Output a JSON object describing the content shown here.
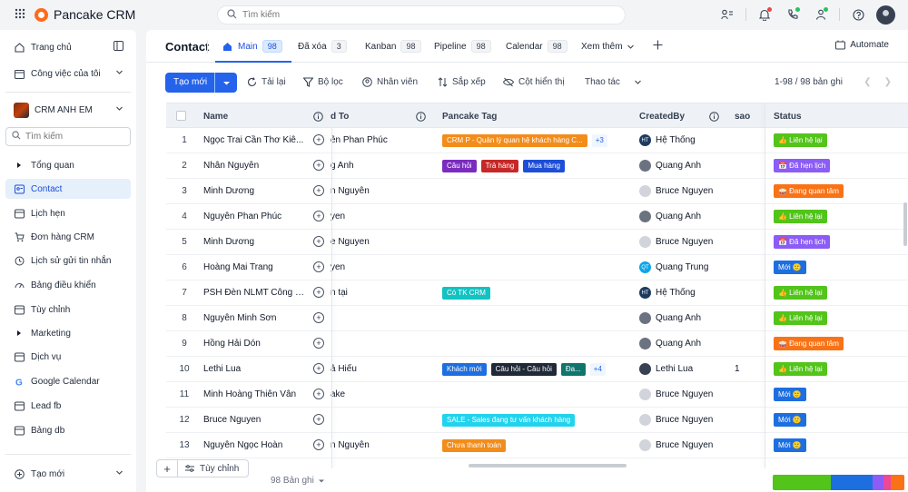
{
  "app": {
    "name": "Pancake CRM",
    "search_placeholder": "Tìm kiếm"
  },
  "sidebar": {
    "top_items": [
      {
        "label": "Trang chủ",
        "icon": "home-icon"
      },
      {
        "label": "Công việc của tôi",
        "icon": "calendar-check-icon"
      }
    ],
    "team": "CRM ANH EM",
    "search_placeholder": "Tìm kiếm",
    "items": [
      {
        "label": "Tổng quan",
        "icon": "caret-right-icon"
      },
      {
        "label": "Contact",
        "icon": "contact-icon"
      },
      {
        "label": "Lịch hẹn",
        "icon": "calendar-icon"
      },
      {
        "label": "Đơn hàng CRM",
        "icon": "cart-icon"
      },
      {
        "label": "Lịch sử gửi tin nhắn",
        "icon": "history-icon"
      },
      {
        "label": "Bảng điều khiển",
        "icon": "dashboard-icon"
      },
      {
        "label": "Tùy chỉnh",
        "icon": "puzzle-icon"
      },
      {
        "label": "Marketing",
        "icon": "caret-right-icon"
      },
      {
        "label": "Dịch vụ",
        "icon": "service-icon"
      },
      {
        "label": "Google Calendar",
        "icon": "google-icon"
      },
      {
        "label": "Lead fb",
        "icon": "table-icon"
      },
      {
        "label": "Bảng db",
        "icon": "table-icon"
      }
    ],
    "new_label": "Tạo mới"
  },
  "header": {
    "title": "Contact",
    "tabs": [
      {
        "label": "Main",
        "count": "98"
      },
      {
        "label": "Đã xóa",
        "count": "3"
      },
      {
        "label": "Kanban",
        "count": "98"
      },
      {
        "label": "Pipeline",
        "count": "98"
      },
      {
        "label": "Calendar",
        "count": "98"
      }
    ],
    "more_label": "Xem thêm",
    "automate_label": "Automate"
  },
  "toolbar": {
    "new_label": "Tạo mới",
    "reload": "Tải lại",
    "filter": "Bộ lọc",
    "staff": "Nhân viên",
    "sort": "Sắp xếp",
    "columns": "Cột hiển thị",
    "actions": "Thao tác",
    "pager": "1-98 / 98 bản ghi"
  },
  "table": {
    "headers": {
      "name": "Name",
      "assigned": "d To",
      "tag": "Pancake Tag",
      "created_by": "CreatedBy",
      "sao": "sao",
      "status": "Status"
    },
    "rows": [
      {
        "num": "1",
        "name": "Ngọc Trai Cần Thơ Kiê...",
        "assigned": "ễn Phan Phúc",
        "tags": [
          {
            "t": "CRM P - Quản lý quan hệ khách hàng C...",
            "c": "#f28c1b"
          }
        ],
        "more": "+3",
        "creator": "Hệ Thống",
        "av": "HT",
        "avc": "#1e3a5f",
        "sao": "",
        "status": "👍 Liên hệ lại",
        "sc": "#52c41a"
      },
      {
        "num": "2",
        "name": "Nhân Nguyễn",
        "assigned": "g Anh",
        "tags": [
          {
            "t": "Câu hỏi",
            "c": "#7b2cbf"
          },
          {
            "t": "Trả hàng",
            "c": "#c62828"
          },
          {
            "t": "Mua hàng",
            "c": "#1d4ed8"
          }
        ],
        "more": "",
        "creator": "Quang Anh",
        "av": "",
        "avc": "#6b7280",
        "sao": "",
        "status": "📅 Đã hẹn lịch",
        "sc": "#8b5cf6"
      },
      {
        "num": "3",
        "name": "Minh Dương",
        "assigned": "n Nguyễn",
        "tags": [],
        "more": "",
        "creator": "Bruce Nguyen",
        "av": "",
        "avc": "#d1d5db",
        "sao": "",
        "status": "🥁 Đang quan tâm",
        "sc": "#f97316"
      },
      {
        "num": "4",
        "name": "Nguyễn Phan Phúc",
        "assigned": "yen",
        "tags": [],
        "more": "",
        "creator": "Quang Anh",
        "av": "",
        "avc": "#6b7280",
        "sao": "",
        "status": "👍 Liên hệ lại",
        "sc": "#52c41a"
      },
      {
        "num": "5",
        "name": "Minh Dương",
        "assigned": "e Nguyen",
        "tags": [],
        "more": "",
        "creator": "Bruce Nguyen",
        "av": "",
        "avc": "#d1d5db",
        "sao": "",
        "status": "📅 Đã hẹn lịch",
        "sc": "#8b5cf6"
      },
      {
        "num": "6",
        "name": "Hoàng Mai Trang",
        "assigned": "yen",
        "tags": [],
        "more": "",
        "creator": "Quang Trung",
        "av": "QT",
        "avc": "#0ea5e9",
        "sao": "",
        "status": "Mới 🙂",
        "sc": "#1d6fe0"
      },
      {
        "num": "7",
        "name": "PSH Đèn NLMT Công S...",
        "assigned": "n tại",
        "tags": [
          {
            "t": "Có TK CRM",
            "c": "#13c2c2"
          }
        ],
        "more": "",
        "creator": "Hệ Thống",
        "av": "HT",
        "avc": "#1e3a5f",
        "sao": "",
        "status": "👍 Liên hệ lại",
        "sc": "#52c41a"
      },
      {
        "num": "8",
        "name": "Nguyễn Minh Sơn",
        "assigned": "",
        "tags": [],
        "more": "",
        "creator": "Quang Anh",
        "av": "",
        "avc": "#6b7280",
        "sao": "",
        "status": "👍 Liên hệ lại",
        "sc": "#52c41a"
      },
      {
        "num": "9",
        "name": "Hồng Hải Dón",
        "assigned": "",
        "tags": [],
        "more": "",
        "creator": "Quang Anh",
        "av": "",
        "avc": "#6b7280",
        "sao": "",
        "status": "🥁 Đang quan tâm",
        "sc": "#f97316"
      },
      {
        "num": "10",
        "name": "Lethi Lua",
        "assigned": "ả Hiếu",
        "tags": [
          {
            "t": "Khách mới",
            "c": "#1d6fe0"
          },
          {
            "t": "Câu hỏi - Câu hỏi",
            "c": "#1f2937"
          },
          {
            "t": "Đa...",
            "c": "#0f766e"
          }
        ],
        "more": "+4",
        "creator": "Lethi Lua",
        "av": "",
        "avc": "#374151",
        "sao": "1",
        "status": "👍 Liên hệ lại",
        "sc": "#52c41a"
      },
      {
        "num": "11",
        "name": "Minh Hoàng Thiên Vân",
        "assigned": "ake",
        "tags": [],
        "more": "",
        "creator": "Bruce Nguyen",
        "av": "",
        "avc": "#d1d5db",
        "sao": "",
        "status": "Mới 🙂",
        "sc": "#1d6fe0"
      },
      {
        "num": "12",
        "name": "Bruce Nguyen",
        "assigned": "",
        "tags": [
          {
            "t": "SALE - Sales đang tư vấn khách hàng",
            "c": "#22d3ee"
          }
        ],
        "more": "",
        "creator": "Bruce Nguyen",
        "av": "",
        "avc": "#d1d5db",
        "sao": "",
        "status": "Mới 🙂",
        "sc": "#1d6fe0"
      },
      {
        "num": "13",
        "name": "Nguyễn Ngọc Hoàn",
        "assigned": "n Nguyễn",
        "tags": [
          {
            "t": "Chưa thanh toán",
            "c": "#f28c1b"
          }
        ],
        "more": "",
        "creator": "Bruce Nguyen",
        "av": "",
        "avc": "#d1d5db",
        "sao": "",
        "status": "Mới 🙂",
        "sc": "#1d6fe0"
      }
    ]
  },
  "footer": {
    "customize": "Tùy chỉnh",
    "count": "98 Bản ghi",
    "status_bar": [
      {
        "pct": 44,
        "color": "#52c41a"
      },
      {
        "pct": 32,
        "color": "#1d6fe0"
      },
      {
        "pct": 8,
        "color": "#8b5cf6"
      },
      {
        "pct": 6,
        "color": "#ec4899"
      },
      {
        "pct": 10,
        "color": "#f97316"
      }
    ]
  }
}
